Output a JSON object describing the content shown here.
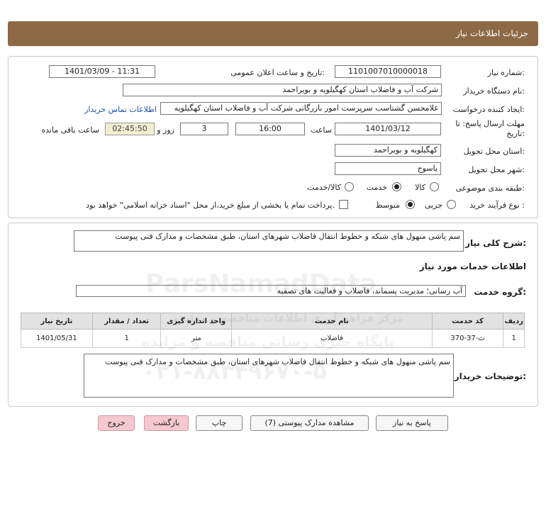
{
  "header": {
    "title": "جزئیات اطلاعات نیاز"
  },
  "form": {
    "need_number_label": "شماره نیاز:",
    "need_number": "1101007010000018",
    "announce_label": "تاریخ و ساعت اعلان عمومی:",
    "announce_value": "1401/03/09 - 11:31",
    "buyer_org_label": "نام دستگاه خریدار:",
    "buyer_org": "شرکت آب و فاضلاب استان کهگیلویه و بویراحمد",
    "creator_label": "ایجاد کننده درخواست:",
    "creator": "غلامحسن گشتاسب سرپرست امور بازرگانی شرکت آب و فاضلاب استان کهگیلویه",
    "contact_link": "اطلاعات تماس خریدار",
    "deadline_label_1": "مهلت ارسال پاسخ: تا",
    "deadline_label_2": "تاریخ:",
    "deadline_date": "1401/03/12",
    "time_label": "ساعت",
    "deadline_time": "16:00",
    "days": "3",
    "days_label": "روز و",
    "remaining": "02:45:50",
    "remaining_label": "ساعت باقی مانده",
    "province_label": "استان محل تحویل:",
    "province": "کهگیلویه و بویراحمد",
    "city_label": "شهر محل تحویل:",
    "city": "یاسوج",
    "category_label": "طبقه بندی موضوعی:",
    "category_options": [
      "کالا",
      "خدمت",
      "کالا/خدمت"
    ],
    "category_selected": "خدمت",
    "purchase_label": "نوع فرآیند خرید :",
    "purchase_options": [
      "جزیی",
      "متوسط"
    ],
    "purchase_selected": "متوسط",
    "treasury_text": "پرداخت تمام یا بخشی از مبلغ خرید،از محل \"اسناد خزانه اسلامی\" خواهد بود."
  },
  "details": {
    "summary_label": "شرح کلی نیاز:",
    "summary": "سم پاشی منهول های شبکه و خطوط انتقال فاضلاب شهرهای استان، طبق مشخصات و مدارک فنی پیوست",
    "services_title": "اطلاعات خدمات مورد نیاز",
    "service_group_label": "گروه خدمت:",
    "service_group": "آب رسانی؛ مدیریت پسماند، فاضلاب و فعالیت های تصفیه",
    "table": {
      "headers": [
        "ردیف",
        "کد خدمت",
        "نام خدمت",
        "واحد اندازه گیری",
        "تعداد / مقدار",
        "تاریخ نیاز"
      ],
      "rows": [
        [
          "1",
          "ث-37-370",
          "فاضلاب",
          "متر",
          "1",
          "1401/05/31"
        ]
      ]
    },
    "buyer_notes_label": "توضیحات خریدار:",
    "buyer_notes": "سم پاشی منهول های شبکه و خطوط انتقال فاضلاب شهرهای استان، طبق مشخصات و مدارک فنی پیوست"
  },
  "buttons": {
    "reply": "پاسخ به نیاز",
    "docs": "مشاهده مدارک پیوستی (7)",
    "print": "چاپ",
    "back": "بازگشت",
    "exit": "خروج"
  },
  "watermark": {
    "line1": "ParsNamadData",
    "line2": "مرکز فراهم آوری اطلاعات مناقصه و مزایده",
    "line3": "پایگاه خبری رسانی مناقصه و مزایده",
    "line4": "۰۲۱-۸۸۳۴۹۶۷۰-۵"
  }
}
